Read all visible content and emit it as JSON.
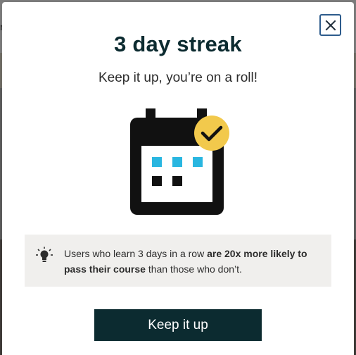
{
  "dialog": {
    "title": "3 day streak",
    "subtitle": "Keep it up, you’re on a roll!",
    "close_icon": "close-icon"
  },
  "tip": {
    "icon": "lightbulb-icon",
    "text_before": "Users who learn 3 days in a row ",
    "text_bold": "are 20x more likely to pass their course",
    "text_after": " than those who don’t."
  },
  "cta": {
    "label": "Keep it up"
  },
  "background": {
    "partial_letter": "r"
  },
  "colors": {
    "title": "#0c2b30",
    "cta_bg": "#0c2b30",
    "check_badge": "#f2c94c",
    "day_done": "#29b6e0",
    "day_missed": "#111111",
    "close_border": "#2d5b8c",
    "tip_bg": "#f0efed"
  }
}
